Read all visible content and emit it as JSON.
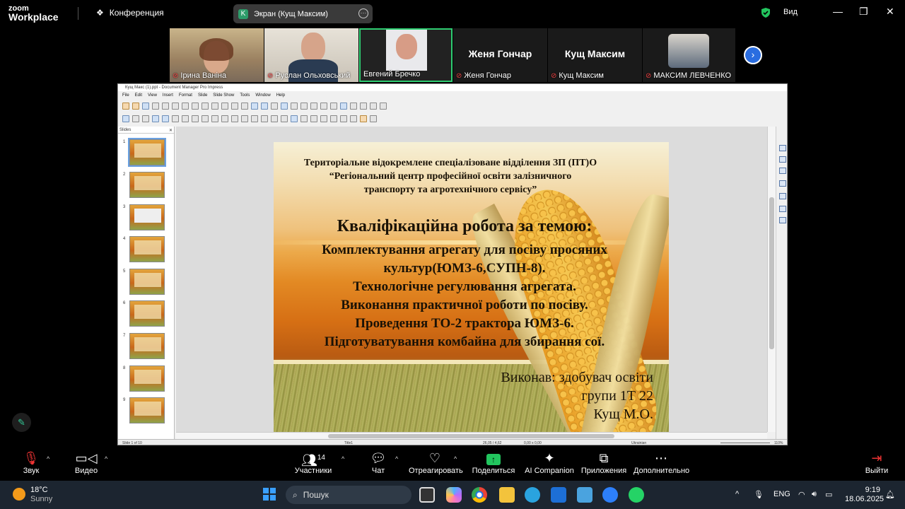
{
  "zoom": {
    "logo_line1": "zoom",
    "logo_line2": "Workplace",
    "meeting_label": "Конференция",
    "screen_share": {
      "badge": "K",
      "title": "Экран (Кущ Максим)",
      "more": "···"
    },
    "view_label": "Вид",
    "window_controls": [
      "—",
      "❐",
      "✕"
    ],
    "participants": [
      {
        "name": "Ірина Ваніна"
      },
      {
        "name": "Руслан Ольховський"
      },
      {
        "name": "Евгений Бречко"
      },
      {
        "name": "Женя Гончар",
        "display": "Женя Гончар"
      },
      {
        "name": "Кущ Максим",
        "display": "Кущ Максим"
      },
      {
        "name": "МАКСИМ ЛЕВЧЕНКО"
      }
    ],
    "toolbar": {
      "audio": "Звук",
      "video": "Видео",
      "participants": "Участники",
      "participants_count": "14",
      "chat": "Чат",
      "react": "Отреагировать",
      "share": "Поделиться",
      "ai": "AI Companion",
      "apps": "Приложения",
      "more": "Дополнительно",
      "leave": "Выйти"
    }
  },
  "impress": {
    "window_title": "Кущ Макс (1).ppt - Document Manager Pro Impress",
    "menu": [
      "File",
      "Edit",
      "View",
      "Insert",
      "Format",
      "Slide",
      "Slide Show",
      "Tools",
      "Window",
      "Help"
    ],
    "slides_panel_title": "Slides",
    "slide_numbers": [
      "1",
      "2",
      "3",
      "4",
      "5",
      "6",
      "7",
      "8",
      "9"
    ],
    "status": {
      "slide": "Slide 1 of 10",
      "layout": "Title1",
      "pos": "26,05 / 4,62",
      "size": "0,00 x 0,00",
      "lang": "Ukrainian",
      "zoom": "110%"
    }
  },
  "slide": {
    "header": [
      "Територіальне відокремлене спеціалізоване відділення ЗП (ПТ)О",
      "“Регіональний центр професійної освіти залізничного",
      "транспорту та агротехнічного сервісу”"
    ],
    "title": "Кваліфікаційна робота за темою:",
    "body": [
      "Комплектування агрегату для посіву просяних",
      "культур(ЮМЗ-6,СУПН-8).",
      "Технологічне регулювання агрегата.",
      "Виконання практичної роботи по посіву.",
      "Проведення ТО-2 трактора ЮМЗ-6.",
      "Підготуватування комбайна для збирання сої."
    ],
    "author": [
      "Виконав: здобувач освіти",
      "групи 1Т 22",
      "Кущ М.О."
    ]
  },
  "taskbar": {
    "temp": "18°C",
    "weather": "Sunny",
    "search": "Пошук",
    "lang": "ENG",
    "time": "9:19",
    "date": "18.06.2025"
  }
}
